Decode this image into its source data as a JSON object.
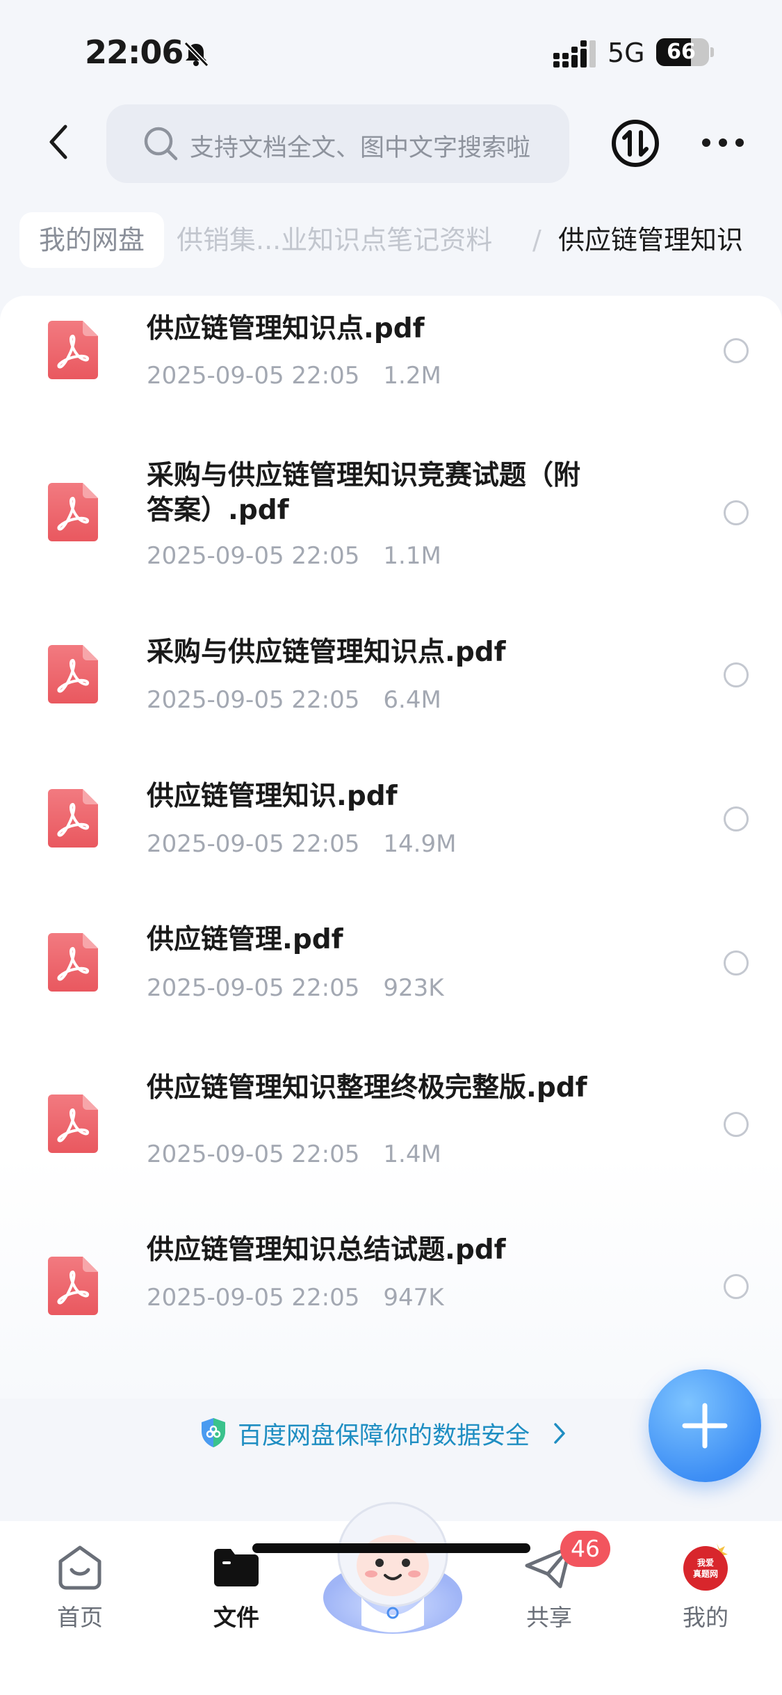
{
  "status_bar": {
    "time": "22:06",
    "network": "5G",
    "battery": "66",
    "battery_level": 0.66
  },
  "header": {
    "search_placeholder": "支持文档全文、图中文字搜索啦"
  },
  "breadcrumb": {
    "root": "我的网盘",
    "middle": "供销集...业知识点笔记资料",
    "separator": "/",
    "current": "供应链管理知识"
  },
  "files": [
    {
      "name": "供应链管理知识点.pdf",
      "date": "2025-09-05 22:05",
      "size": "1.2M"
    },
    {
      "name": "采购与供应链管理知识竞赛试题（附答案）.pdf",
      "date": "2025-09-05 22:05",
      "size": "1.1M"
    },
    {
      "name": "采购与供应链管理知识点.pdf",
      "date": "2025-09-05 22:05",
      "size": "6.4M"
    },
    {
      "name": "供应链管理知识.pdf",
      "date": "2025-09-05 22:05",
      "size": "14.9M"
    },
    {
      "name": "供应链管理.pdf",
      "date": "2025-09-05 22:05",
      "size": "923K"
    },
    {
      "name": "供应链管理知识整理终极完整版.pdf",
      "date": "2025-09-05 22:05",
      "size": "1.4M"
    },
    {
      "name": "供应链管理知识总结试题.pdf",
      "date": "2025-09-05 22:05",
      "size": "947K"
    }
  ],
  "security_banner": {
    "text": "百度网盘保障你的数据安全"
  },
  "tabs": [
    {
      "label": "首页",
      "icon": "home-icon"
    },
    {
      "label": "文件",
      "icon": "folder-icon",
      "active": true
    },
    {
      "label": "共享",
      "icon": "paper-plane-icon",
      "badge": "46"
    },
    {
      "label": "我的",
      "icon": "avatar-icon",
      "avatar_text": "我爱真题网"
    }
  ],
  "colors": {
    "accent": "#3e8ff5",
    "pdf_red": "#ef6b73",
    "badge_red": "#f2555e",
    "security_text": "#1f8ec2"
  }
}
